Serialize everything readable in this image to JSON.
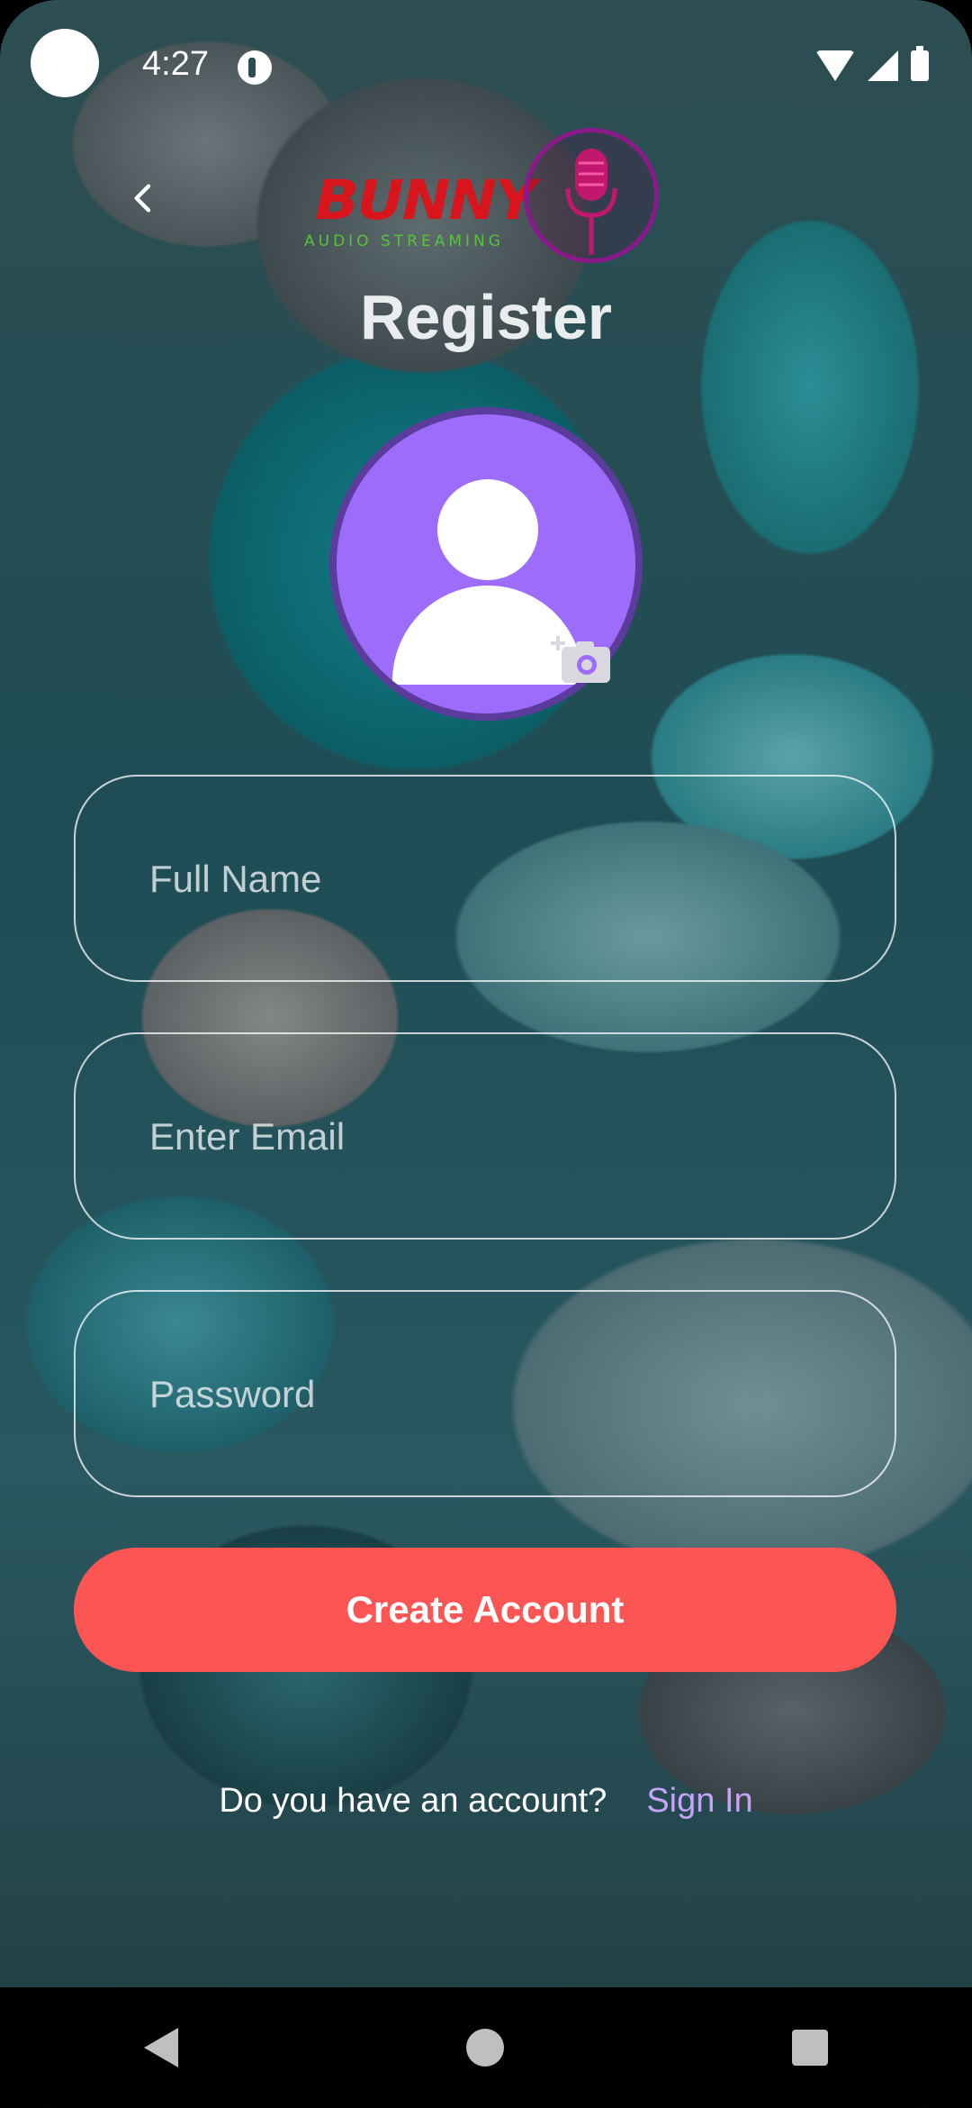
{
  "status_bar": {
    "time": "4:27",
    "icons": [
      "camera-dot",
      "notification-icon",
      "wifi-icon",
      "signal-icon",
      "battery-icon"
    ]
  },
  "header": {
    "back_icon": "chevron-left-icon",
    "logo_text": "BUNNY",
    "logo_subtitle": "AUDIO STREAMING",
    "logo_icon": "microphone-icon",
    "title": "Register"
  },
  "avatar": {
    "icon": "person-icon",
    "add_photo_icon": "add-photo-camera-icon"
  },
  "form": {
    "full_name_placeholder": "Full Name",
    "email_placeholder": "Enter Email",
    "password_placeholder": "Password",
    "full_name_value": "",
    "email_value": "",
    "password_value": ""
  },
  "actions": {
    "create_account_label": "Create Account",
    "signin_prompt": "Do you have an account?",
    "signin_link": "Sign In"
  },
  "nav_bar": {
    "icons": [
      "nav-back-icon",
      "nav-home-icon",
      "nav-recents-icon"
    ]
  },
  "colors": {
    "primary_button": "#fc5554",
    "avatar_fill": "#9d6cfb",
    "link": "#c6a3f6",
    "logo_red": "#d8141c",
    "logo_green": "#58c43a",
    "logo_purple": "#8a1a8c"
  }
}
